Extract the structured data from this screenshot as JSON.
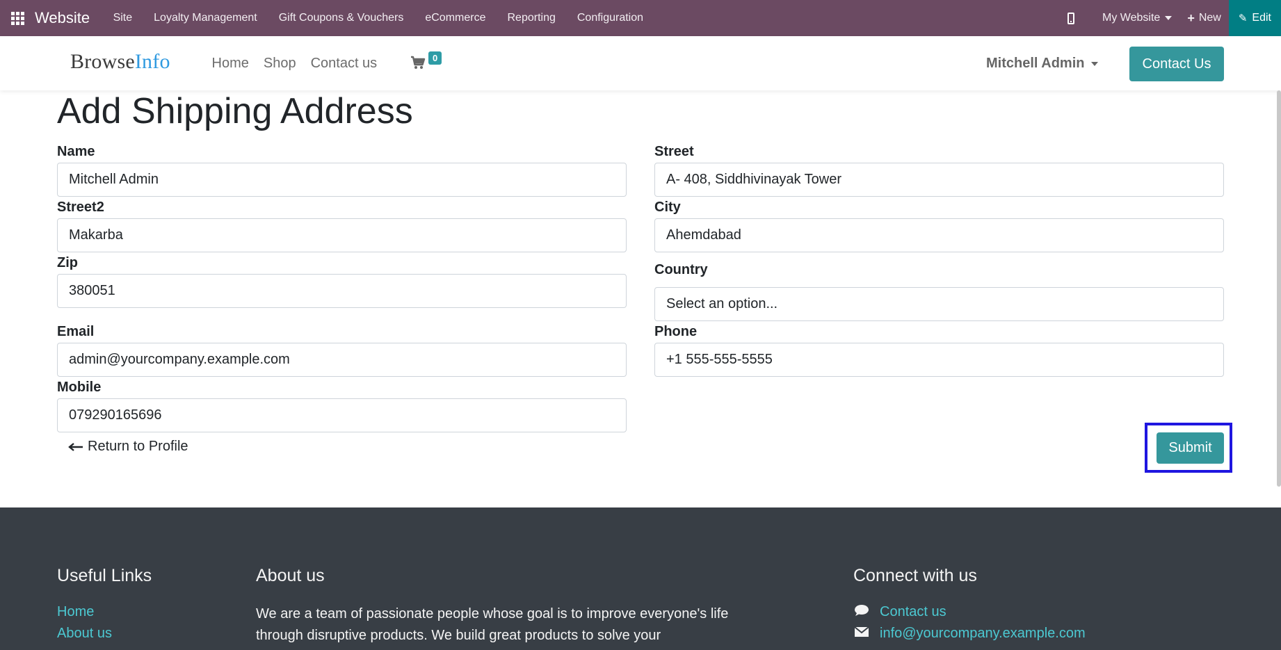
{
  "adminbar": {
    "brand": "Website",
    "menu": [
      "Site",
      "Loyalty Management",
      "Gift Coupons & Vouchers",
      "eCommerce",
      "Reporting",
      "Configuration"
    ],
    "my_website": "My Website",
    "new": "New",
    "edit": "Edit"
  },
  "header": {
    "logo_part1": "Browse",
    "logo_part2": "Info",
    "nav": [
      "Home",
      "Shop",
      "Contact us"
    ],
    "cart_count": "0",
    "user": "Mitchell Admin",
    "contact_button": "Contact Us"
  },
  "form": {
    "title": "Add Shipping Address",
    "name_label": "Name",
    "name_value": "Mitchell Admin",
    "street_label": "Street",
    "street_value": "A- 408, Siddhivinayak Tower",
    "street2_label": "Street2",
    "street2_value": "Makarba",
    "city_label": "City",
    "city_value": "Ahemdabad",
    "zip_label": "Zip",
    "zip_value": "380051",
    "country_label": "Country",
    "country_value": "Select an option...",
    "email_label": "Email",
    "email_value": "admin@yourcompany.example.com",
    "phone_label": "Phone",
    "phone_value": "+1 555-555-5555",
    "mobile_label": "Mobile",
    "mobile_value": "079290165696",
    "return_link": "Return to Profile",
    "submit": "Submit"
  },
  "footer": {
    "useful_links_title": "Useful Links",
    "links": [
      "Home",
      "About us"
    ],
    "about_title": "About us",
    "about_text": "We are a team of passionate people whose goal is to improve everyone's life through disruptive products. We build great products to solve your",
    "connect_title": "Connect with us",
    "contact_link": "Contact us",
    "email_link": "info@yourcompany.example.com"
  },
  "colors": {
    "adminbar": "#6b4a62",
    "edit": "#017e84",
    "primary": "#35979c",
    "footer": "#383e45",
    "footer_link": "#4cc9d2",
    "highlight": "#1f16e0"
  }
}
